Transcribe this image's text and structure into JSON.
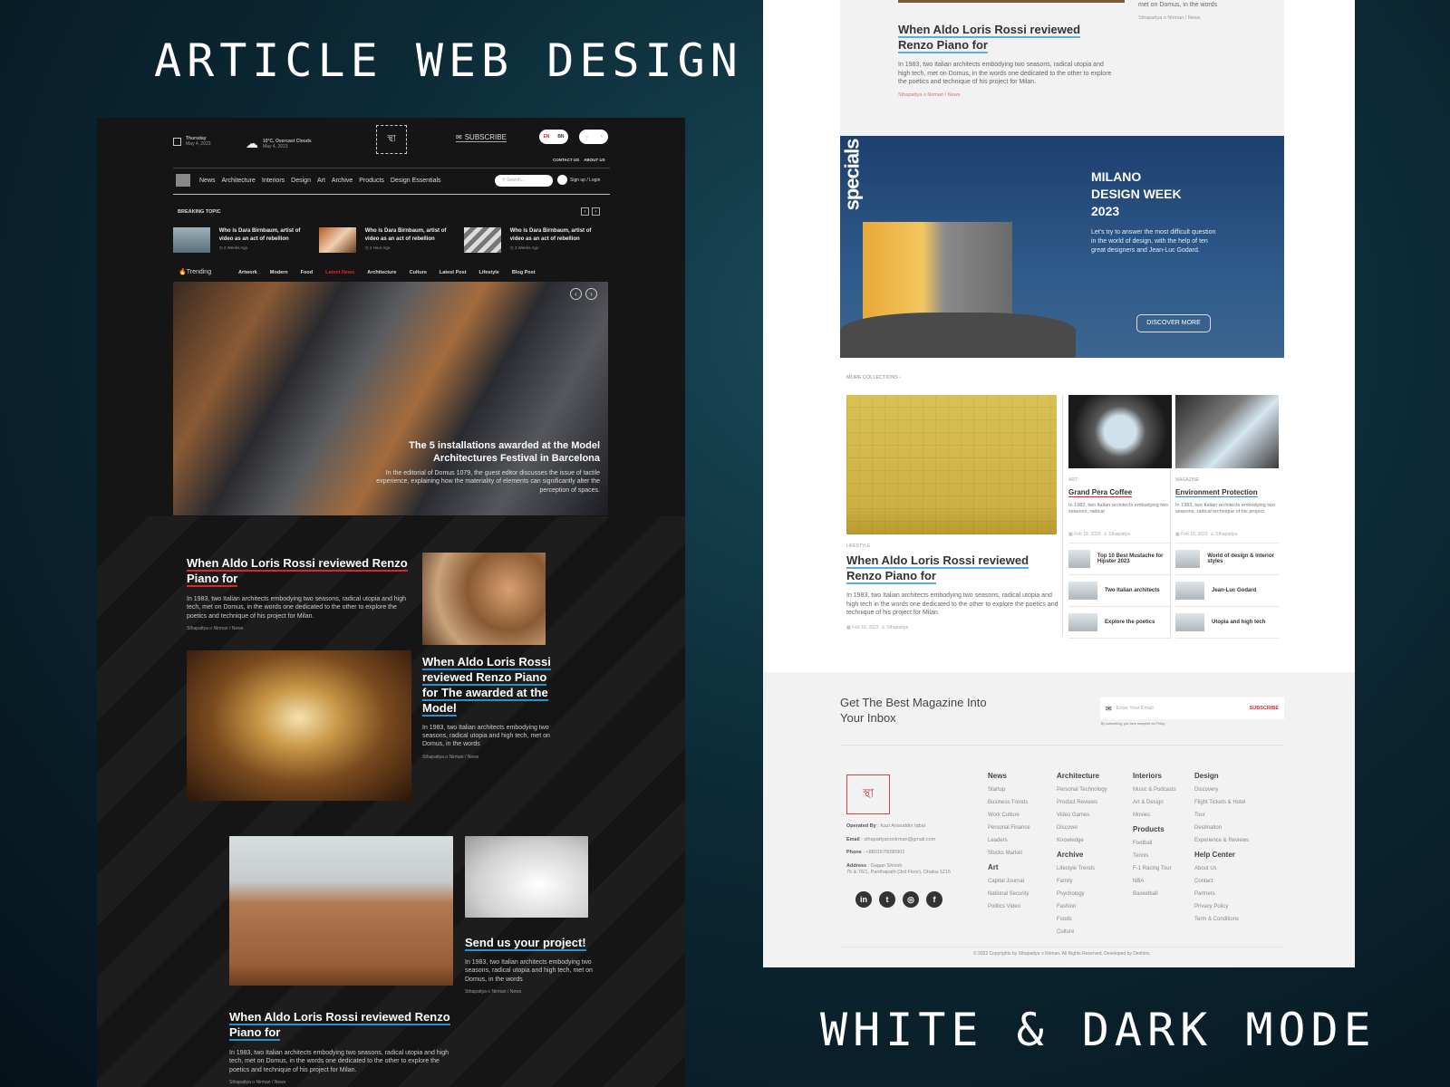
{
  "headings": {
    "left": "ARTICLE WEB DESIGN",
    "right": "WHITE & DARK MODE"
  },
  "dark": {
    "date": {
      "day": "Thursday",
      "date": "May 4, 2023"
    },
    "weather": {
      "text": "10°C, Overcast Clouds",
      "date": "May 4, 2023"
    },
    "subscribe": "SUBSCRIBE",
    "lang": [
      "EN",
      "BN"
    ],
    "top_links": [
      "CONTACT US",
      "ABOUT US"
    ],
    "nav": [
      "News",
      "Architecture",
      "Interiors",
      "Design",
      "Art",
      "Archive",
      "Products",
      "Design Essentials"
    ],
    "search_placeholder": "Search...",
    "login": "Sign up / Login",
    "breaking": {
      "label": "BREAKING TOPIC",
      "items": [
        {
          "title": "Who is Dara Birnbaum, artist of video as an act of rebellion",
          "time": "2 Weeks Ago"
        },
        {
          "title": "Who is Dara Birnbaum, artist of video as an act of rebellion",
          "time": "2 Hour Ago"
        },
        {
          "title": "Who is Dara Birnbaum, artist of video as an act of rebellion",
          "time": "3 Weeks Ago"
        }
      ]
    },
    "trending": {
      "label": "Trending",
      "tags": [
        "Artwork",
        "Modern",
        "Food",
        "Latest News",
        "Architecture",
        "Culture",
        "Latest Post",
        "Lifestyle",
        "Blog Post"
      ],
      "active": "Latest News"
    },
    "hero": {
      "title": "The 5 installations awarded at the Model Architectures Festival in Barcelona",
      "text": "In the editorial of Domus 1079, the guest editor discusses the issue of tactile experience, explaining how the materiality of elements can significantly alter the perception of spaces."
    },
    "articles": [
      {
        "title": "When Aldo Loris Rossi reviewed Renzo Piano for",
        "text": "In 1983, two Italian architects embodying two seasons, radical utopia and high tech, met on Domus, in the words one dedicated to the other to explore the poetics and technique of his project for Milan.",
        "meta": "Sthapattya o Nirman / News"
      },
      {
        "title": "When Aldo Loris Rossi reviewed Renzo Piano for The awarded at the Model",
        "text": "In 1983, two Italian architects embodying two seasons, radical utopia and high tech, met on Domus, in the words",
        "meta": "Sthapattya o Nirman / News"
      },
      {
        "title": "Send us your project!",
        "text": "In 1983, two Italian architects embodying two seasons, radical utopia and high tech, met on Domus, in the words",
        "meta": "Sthapattya o Nirman / News"
      },
      {
        "title": "When Aldo Loris Rossi reviewed Renzo Piano for",
        "text": "In 1983, two Italian architects embodying two seasons, radical utopia and high tech, met on Domus, in the words one dedicated to the other to explore the poetics and technique of his project for Milan.",
        "meta": "Sthapattya o Nirman / News"
      }
    ]
  },
  "white": {
    "top_article": {
      "title": "When Aldo Loris Rossi reviewed Renzo Piano for",
      "text": "In 1983, two Italian architects embodying two seasons, radical utopia and high tech, met on Domus, in the words one dedicated to the other to explore the poetics and technique of his project for Milan.",
      "meta": "Sthapattya o Nirman / News",
      "side_text": "met on Domus, in the words",
      "side_meta": "Sthapattya o Nirman / News"
    },
    "specials": {
      "label": "specials",
      "title": "MILANO DESIGN WEEK 2023",
      "text": "Let's try to answer the most difficult question in the world of design, with the help of ten great designers and Jean-Luc Godard.",
      "button": "DISCOVER MORE"
    },
    "more_collections": "MORE COLLECTIONS",
    "feature": {
      "category": "LIFESTYLE",
      "title": "When Aldo Loris Rossi reviewed Renzo Piano for",
      "text": "In 1983, two Italian architects embodying two seasons, radical utopia and high tech in the words one dedicated to the other to explore the poetics and technique of his project for Milan.",
      "date": "Feb 18, 2023",
      "author": "Sthapattya"
    },
    "cols": [
      {
        "category": "ART",
        "title": "Grand Pera Coffee",
        "text": "In 1983, two Italian architects embodying two seasons, radical",
        "date": "Feb 18, 2023",
        "author": "Sthapattya",
        "list": [
          "Top 10 Best Mustache for Hipster 2023",
          "Two Italian architects",
          "Explore the poetics"
        ]
      },
      {
        "category": "MAGAZINE",
        "title": "Environment Protection",
        "text": "In 1983, two Italian architects embodying two seasons, radical technique of his project.",
        "date": "Feb 18, 2023",
        "author": "Sthapattya",
        "list": [
          "World of design & Interior styles",
          "Jean-Luc Godard",
          "Utopia and high tech"
        ]
      }
    ],
    "newsletter": {
      "title": "Get The Best Magazine Into Your Inbox",
      "placeholder": "Enter Your Email",
      "button": "SUBSCRIBE",
      "note": "By subscribing, you have accepted our Policy"
    },
    "contact": {
      "operated_label": "Operated By",
      "operated": "Kazi Anisuddin Iqbal",
      "email_label": "Email",
      "email": "sthapattyanonirman@gmail.com",
      "phone_label": "Phone",
      "phone": "+8801679090901",
      "address_label": "Address",
      "address1": "Gagan Shirish",
      "address2": "76 & 76/1, Panthapath (3rd Floor), Dhaka-1215"
    },
    "social": [
      "linkedin",
      "twitter",
      "instagram",
      "facebook"
    ],
    "footer_cols": [
      [
        {
          "h": "News",
          "items": [
            "Startup",
            "Business Trends",
            "Work Culture",
            "Personal Finance",
            "Leaders",
            "Stocks Market"
          ]
        },
        {
          "h": "Art",
          "items": [
            "Capital Journal",
            "National Security",
            "Politics Video"
          ]
        }
      ],
      [
        {
          "h": "Architecture",
          "items": [
            "Personal Technology",
            "Product Reviews",
            "Video Games",
            "Discover",
            "Knowledge"
          ]
        },
        {
          "h": "Archive",
          "items": [
            "Lifestyle Trends",
            "Family",
            "Psychology",
            "Fashion",
            "Foods",
            "Culture"
          ]
        }
      ],
      [
        {
          "h": "Interiors",
          "items": [
            "Music & Podcasts",
            "Art & Design",
            "Movies"
          ]
        },
        {
          "h": "Products",
          "items": [
            "Football",
            "Tennis",
            "F-1 Racing Tour",
            "NBA",
            "Basketball"
          ]
        }
      ],
      [
        {
          "h": "Design",
          "items": [
            "Discovery",
            "Flight Tickets & Hotel",
            "Tour",
            "Destination",
            "Experience & Reviews"
          ]
        },
        {
          "h": "Help Center",
          "items": [
            "About Us",
            "Contact",
            "Partners",
            "Privacy Policy",
            "Term & Conditions"
          ]
        }
      ]
    ],
    "copyright": "© 2022 Copyrights by Sthapattya o Nirman. All Rights Reserved. Developed by DeshInc."
  },
  "colors": {
    "accent_red": "#d9272e",
    "accent_blue": "#2b8fd6",
    "dark_bg": "#151515",
    "specials_bg": "#2d5a8c"
  }
}
